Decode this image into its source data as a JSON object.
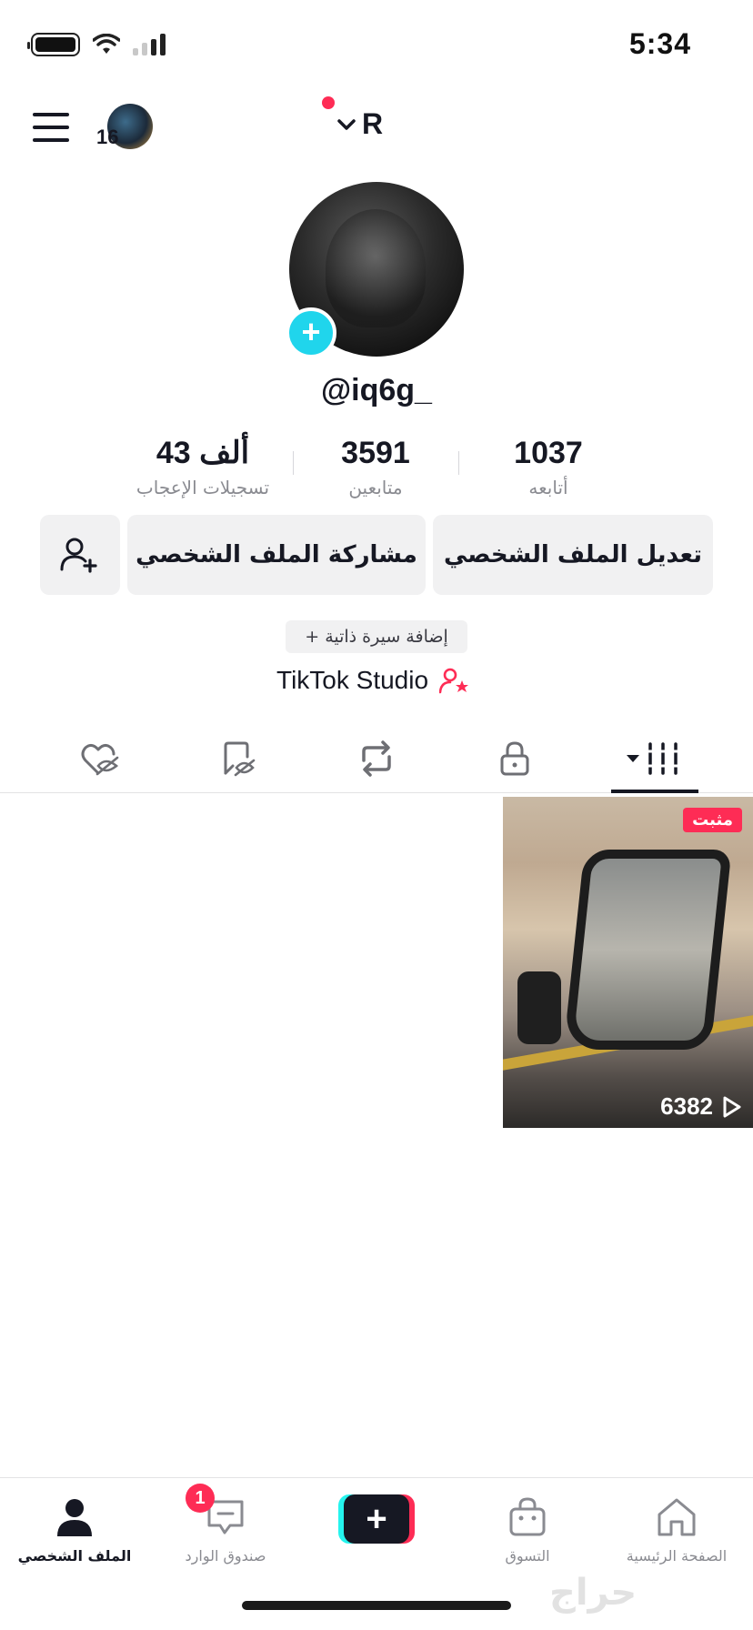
{
  "status_bar": {
    "time": "5:34"
  },
  "top_nav": {
    "account_initial": "R",
    "avatar_count": "16"
  },
  "profile": {
    "handle": "@iq6g_",
    "stats": {
      "following": {
        "value": "1037",
        "label": "أتابعه"
      },
      "followers": {
        "value": "3591",
        "label": "متابعين"
      },
      "likes": {
        "value": "43 ألف",
        "label": "تسجيلات الإعجاب"
      }
    },
    "buttons": {
      "edit_profile": "تعديل الملف الشخصي",
      "share_profile": "مشاركة الملف الشخصي"
    },
    "add_bio": "+ إضافة سيرة ذاتية",
    "studio_link": "TikTok Studio"
  },
  "tabs": [
    {
      "name": "videos",
      "icon": "grid-icon",
      "active": true
    },
    {
      "name": "private",
      "icon": "lock-icon",
      "active": false
    },
    {
      "name": "reposts",
      "icon": "repost-icon",
      "active": false
    },
    {
      "name": "favorites",
      "icon": "bookmark-hidden-icon",
      "active": false
    },
    {
      "name": "liked",
      "icon": "heart-hidden-icon",
      "active": false
    }
  ],
  "videos": [
    {
      "pinned_label": "مثبت",
      "views": "6382"
    }
  ],
  "bottom_nav": {
    "home": "الصفحة الرئيسية",
    "shop": "التسوق",
    "inbox": "صندوق الوارد",
    "inbox_badge": "1",
    "profile": "الملف الشخصي"
  },
  "colors": {
    "accent": "#fe2c55",
    "cyan": "#20d5ec",
    "text": "#161823",
    "muted": "#8a8b91",
    "button_bg": "#f1f1f2"
  },
  "watermark": "حراج"
}
